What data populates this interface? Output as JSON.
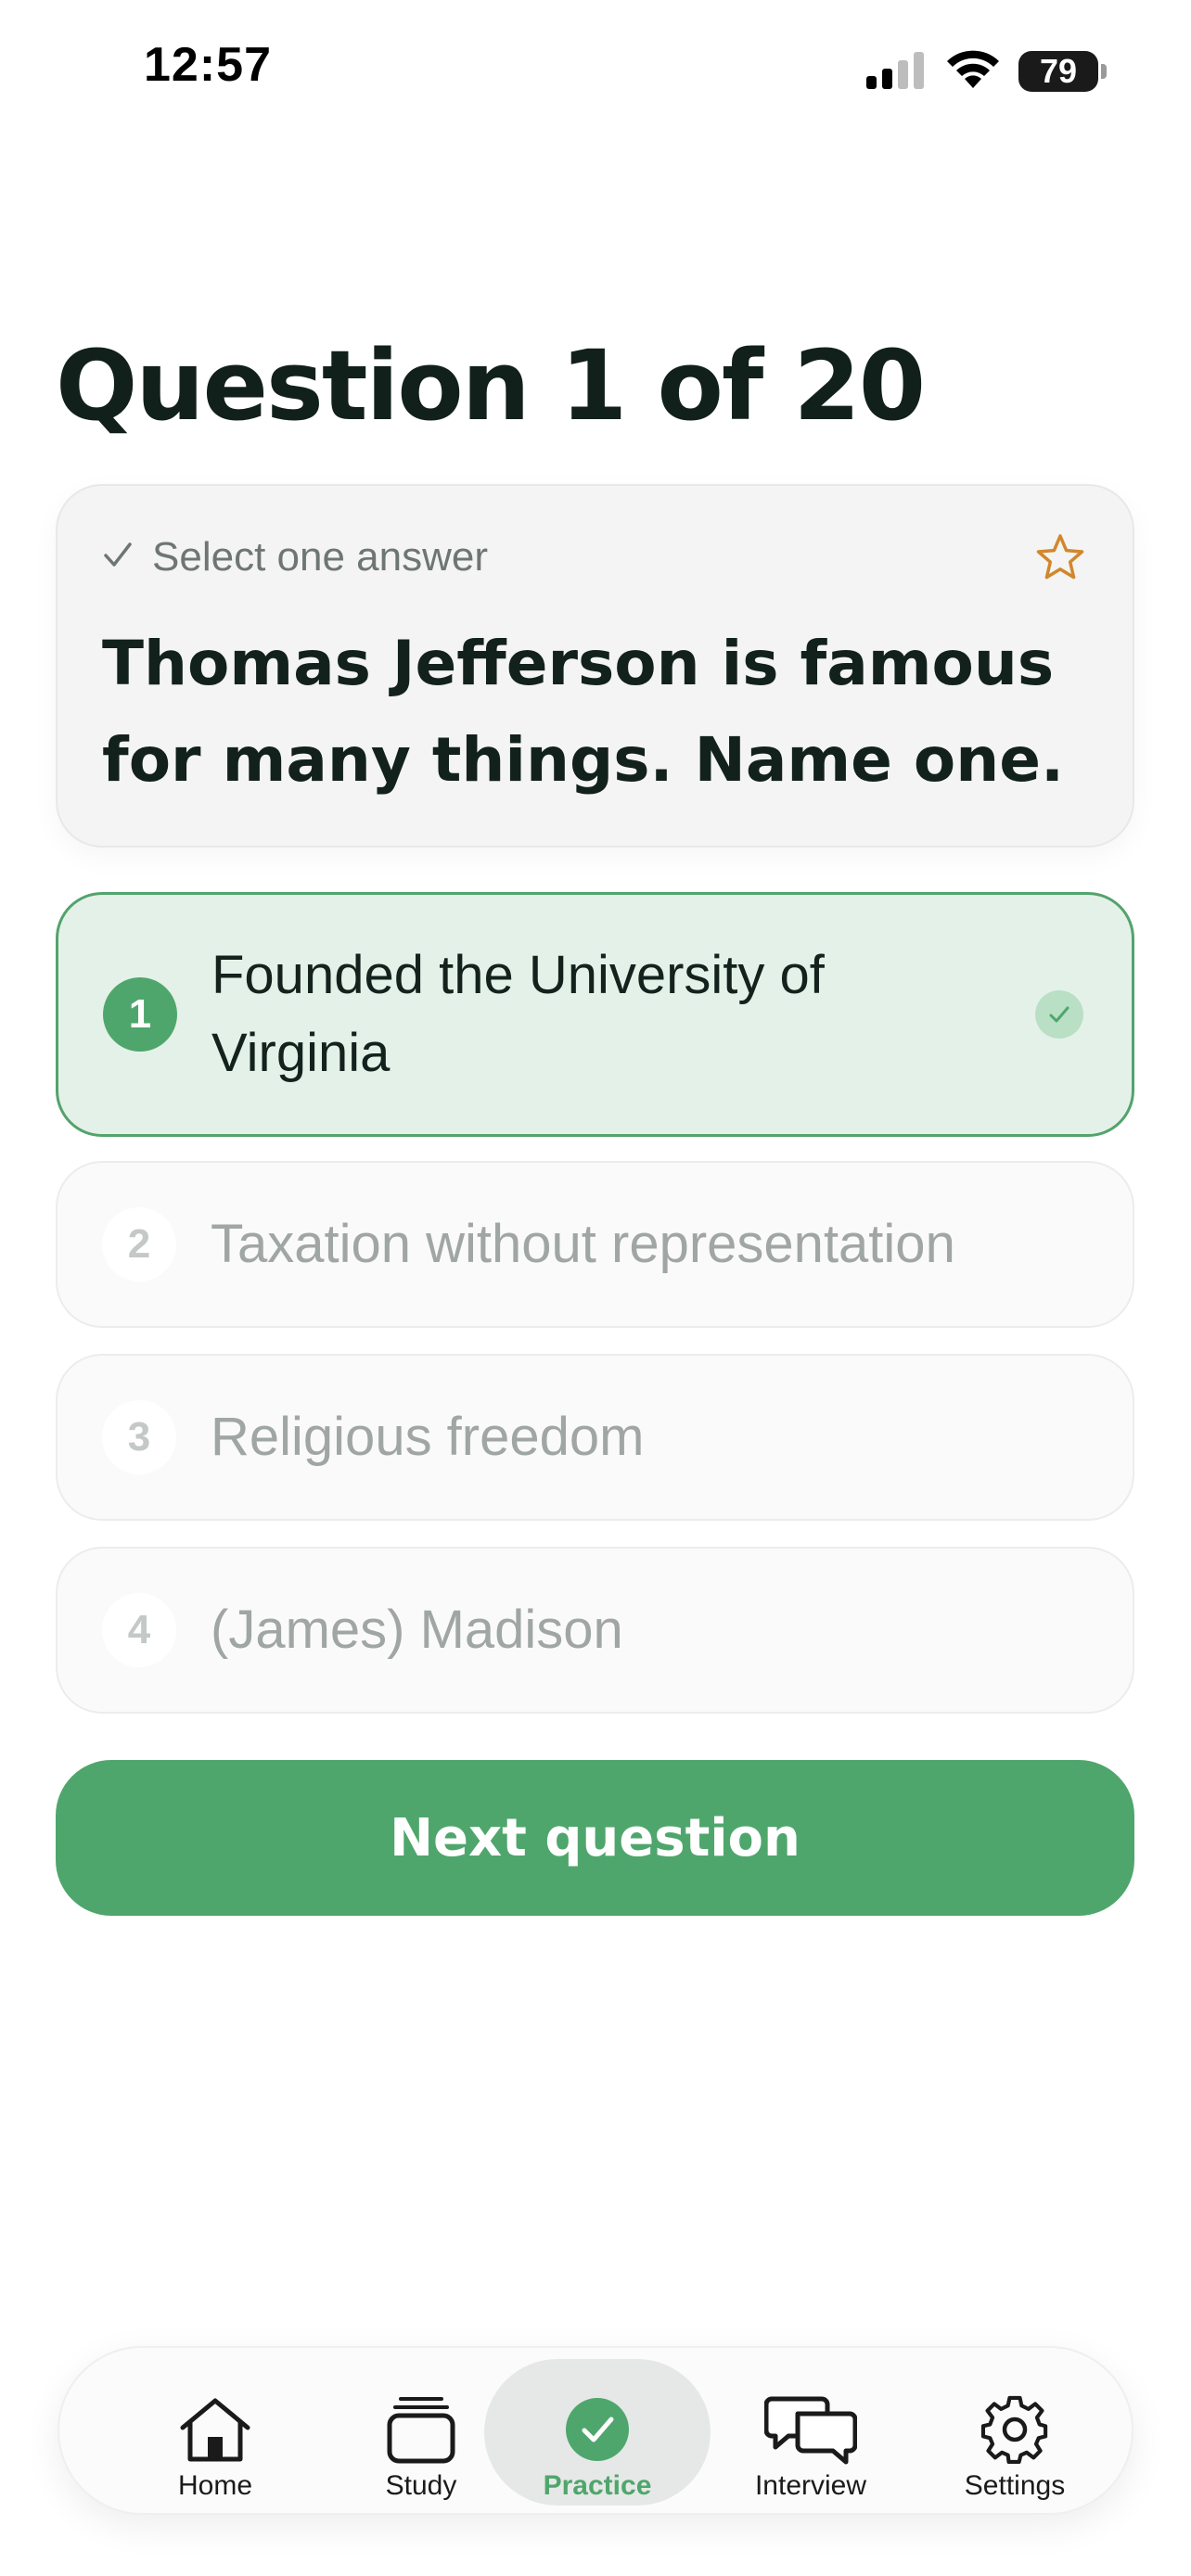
{
  "status_bar": {
    "time": "12:57",
    "battery": "79",
    "icons": [
      "signal-icon",
      "wifi-icon",
      "battery-icon"
    ]
  },
  "header": {
    "title": "Question 1 of 20"
  },
  "question": {
    "hint": "Select one answer",
    "text": "Thomas Jefferson is famous for many things. Name one.",
    "favorite_icon": "star-icon"
  },
  "answers": [
    {
      "number": "1",
      "text": "Founded the University of Virginia",
      "selected": true
    },
    {
      "number": "2",
      "text": "Taxation without representation",
      "selected": false
    },
    {
      "number": "3",
      "text": "Religious freedom",
      "selected": false
    },
    {
      "number": "4",
      "text": "(James) Madison",
      "selected": false
    }
  ],
  "actions": {
    "next_label": "Next question"
  },
  "tab_bar": {
    "items": [
      {
        "label": "Home",
        "icon": "home-icon",
        "active": false
      },
      {
        "label": "Study",
        "icon": "cards-icon",
        "active": false
      },
      {
        "label": "Practice",
        "icon": "check-circle-icon",
        "active": true
      },
      {
        "label": "Interview",
        "icon": "chat-bubbles-icon",
        "active": false
      },
      {
        "label": "Settings",
        "icon": "gear-icon",
        "active": false
      }
    ]
  },
  "colors": {
    "accent": "#4fa66c",
    "selected_bg": "#e4f1e8",
    "star": "#d2872c"
  }
}
